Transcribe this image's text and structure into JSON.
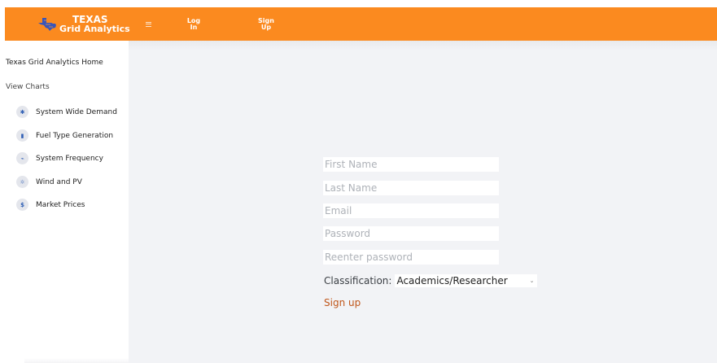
{
  "header": {
    "brand_title": "TEXAS",
    "brand_subtitle": "Grid Analytics",
    "login": "Log\nIn",
    "signup": "Sign\nUp",
    "accent_color": "#fb8a1f"
  },
  "sidebar": {
    "home": "Texas Grid Analytics Home",
    "view_charts": "View Charts",
    "items": [
      {
        "label": "System Wide Demand",
        "icon": "lightbulb-icon"
      },
      {
        "label": "Fuel Type Generation",
        "icon": "fuel-icon"
      },
      {
        "label": "System Frequency",
        "icon": "pulse-icon"
      },
      {
        "label": "Wind and PV",
        "icon": "sun-icon"
      },
      {
        "label": "Market Prices",
        "icon": "dollar-icon"
      }
    ]
  },
  "form": {
    "first_name_placeholder": "First Name",
    "last_name_placeholder": "Last Name",
    "email_placeholder": "Email",
    "password_placeholder": "Password",
    "reenter_placeholder": "Reenter password",
    "classification_label": "Classification:",
    "classification_value": "Academics/Researcher",
    "submit": "Sign up",
    "submit_color": "#c0561a"
  }
}
